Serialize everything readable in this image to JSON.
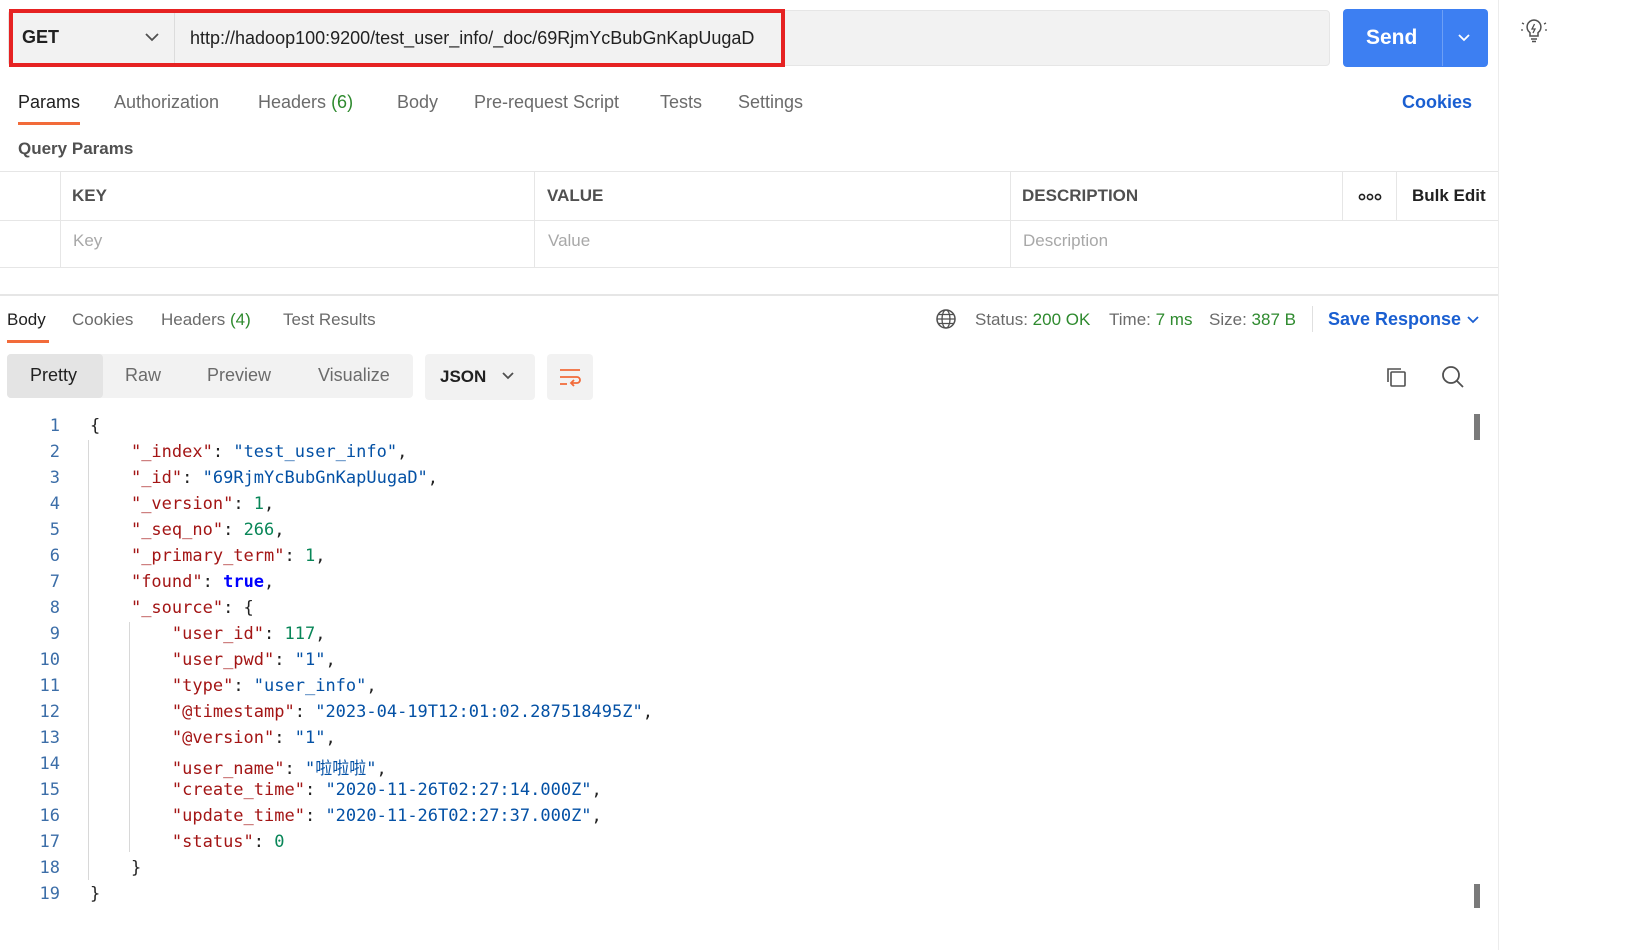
{
  "request": {
    "method": "GET",
    "url": "http://hadoop100:9200/test_user_info/_doc/69RjmYcBubGnKapUugaD",
    "send_label": "Send"
  },
  "request_tabs": [
    {
      "label": "Params"
    },
    {
      "label": "Authorization"
    },
    {
      "label": "Headers",
      "count": "(6)"
    },
    {
      "label": "Body"
    },
    {
      "label": "Pre-request Script"
    },
    {
      "label": "Tests"
    },
    {
      "label": "Settings"
    }
  ],
  "cookies_label": "Cookies",
  "query_params": {
    "title": "Query Params",
    "columns": [
      "KEY",
      "VALUE",
      "DESCRIPTION"
    ],
    "placeholders": [
      "Key",
      "Value",
      "Description"
    ],
    "bulk_edit": "Bulk Edit"
  },
  "response_tabs": [
    {
      "label": "Body"
    },
    {
      "label": "Cookies"
    },
    {
      "label": "Headers",
      "count": "(4)"
    },
    {
      "label": "Test Results"
    }
  ],
  "status": {
    "status_label": "Status:",
    "status_value": "200 OK",
    "time_label": "Time:",
    "time_value": "7 ms",
    "size_label": "Size:",
    "size_value": "387 B",
    "save_response": "Save Response"
  },
  "view_modes": [
    "Pretty",
    "Raw",
    "Preview",
    "Visualize"
  ],
  "format": "JSON",
  "colors": {
    "accent": "#3d7ff2",
    "highlight_box": "#e62222",
    "tab_indicator": "#f26b3a",
    "success": "#2e8a2e"
  },
  "code_lines": [
    "{",
    "    \"_index\": \"test_user_info\",",
    "    \"_id\": \"69RjmYcBubGnKapUugaD\",",
    "    \"_version\": 1,",
    "    \"_seq_no\": 266,",
    "    \"_primary_term\": 1,",
    "    \"found\": true,",
    "    \"_source\": {",
    "        \"user_id\": 117,",
    "        \"user_pwd\": \"1\",",
    "        \"type\": \"user_info\",",
    "        \"@timestamp\": \"2023-04-19T12:01:02.287518495Z\",",
    "        \"@version\": \"1\",",
    "        \"user_name\": \"啦啦啦\",",
    "        \"create_time\": \"2020-11-26T02:27:14.000Z\",",
    "        \"update_time\": \"2020-11-26T02:27:37.000Z\",",
    "        \"status\": 0",
    "    }",
    "}"
  ]
}
